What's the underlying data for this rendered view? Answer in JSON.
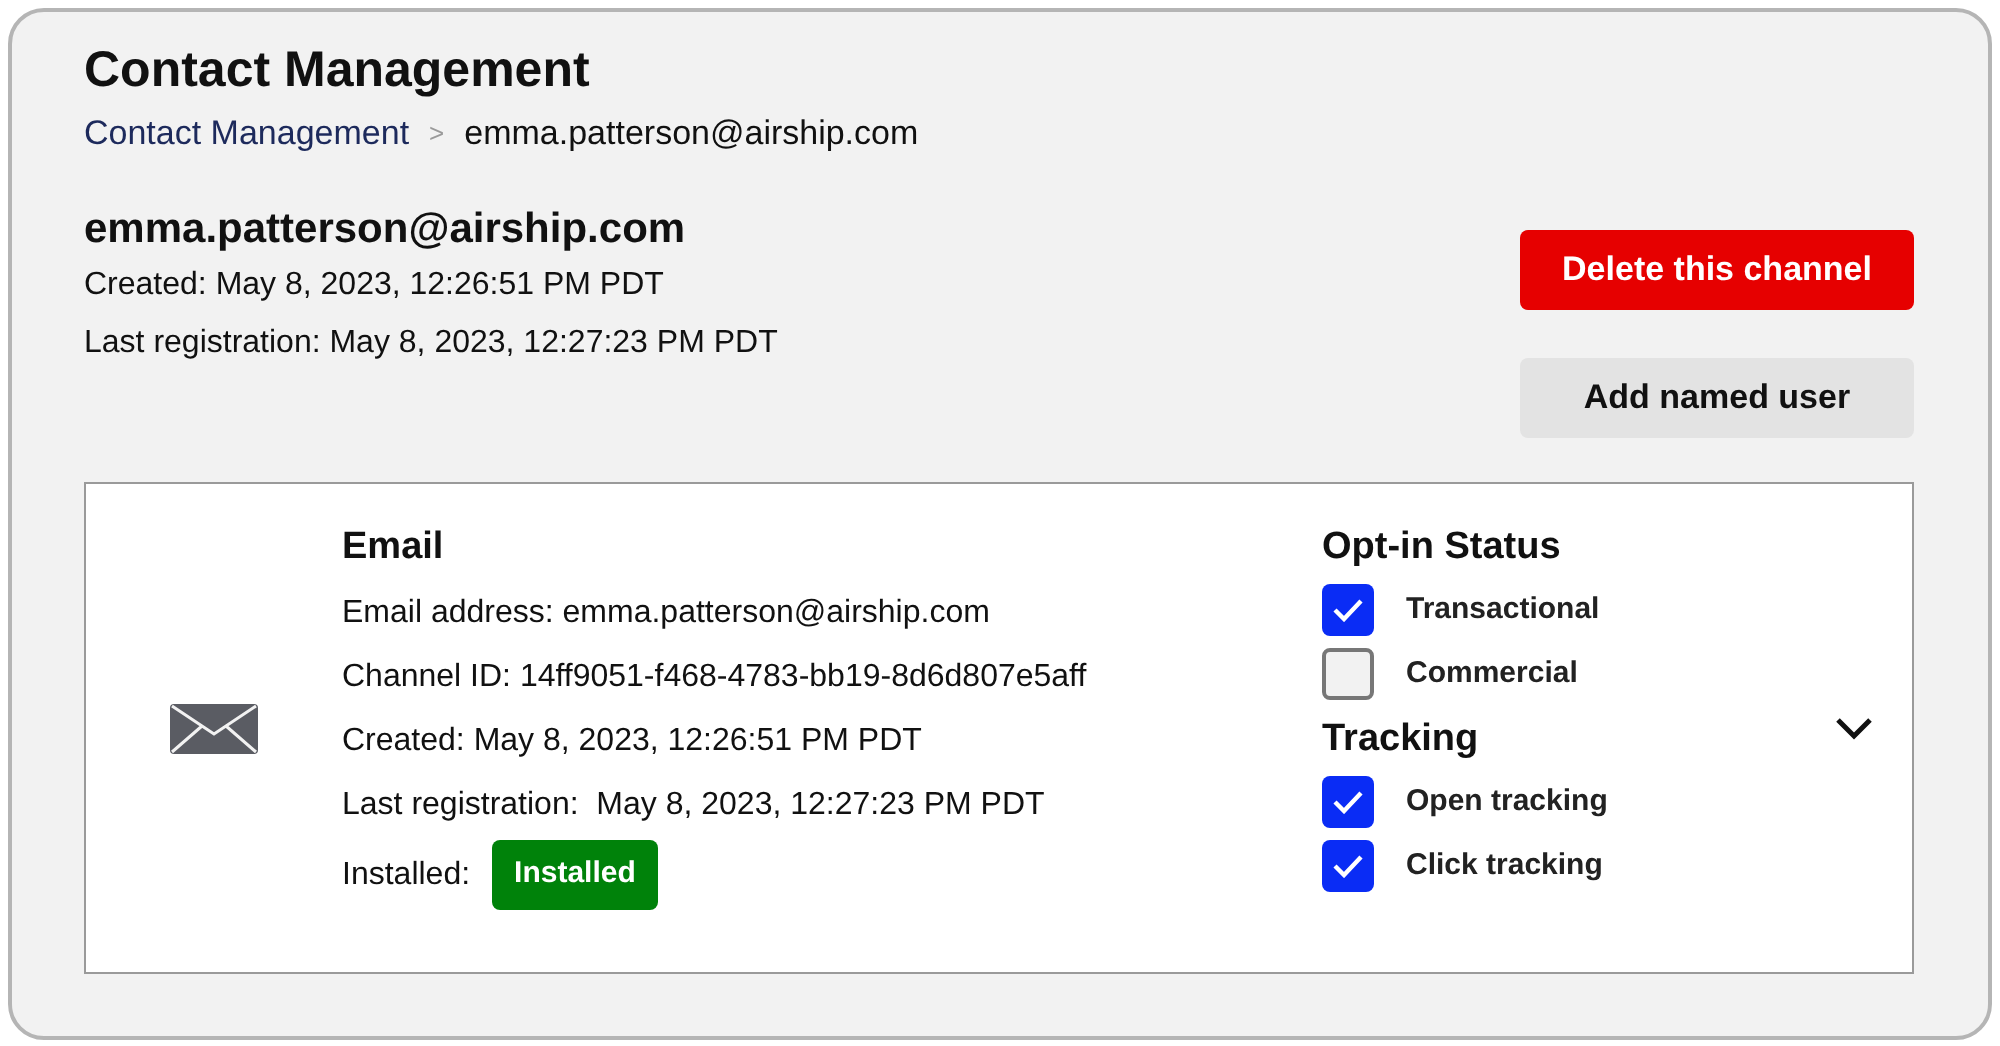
{
  "title": "Contact Management",
  "breadcrumb": {
    "link": "Contact Management",
    "separator": ">",
    "current": "emma.patterson@airship.com"
  },
  "channel": {
    "heading": "emma.patterson@airship.com",
    "details": [
      "Created: May 8, 2023, 12:26:51 PM PDT",
      "Last registration: May 8, 2023, 12:27:23 PM PDT"
    ]
  },
  "buttons": [
    {
      "label": "Delete this channel",
      "kind": "danger"
    },
    {
      "label": "Add named user",
      "kind": "secondary"
    }
  ],
  "card": {
    "title": "Email",
    "lines": [
      "Email address: emma.patterson@airship.com",
      "Channel ID: 14ff9051-f468-4783-bb19-8d6d807e5aff",
      "Created: May 8, 2023, 12:26:51 PM PDT",
      "Last registration:  May 8, 2023, 12:27:23 PM PDT"
    ],
    "installed": {
      "label": "Installed:",
      "badge": "Installed"
    },
    "groups": [
      {
        "heading": "Opt-in Status",
        "items": [
          {
            "label": "Transactional",
            "checked": true
          },
          {
            "label": "Commercial",
            "checked": false
          }
        ]
      },
      {
        "heading": "Tracking",
        "items": [
          {
            "label": "Open tracking",
            "checked": true
          },
          {
            "label": "Click tracking",
            "checked": true
          }
        ]
      }
    ]
  }
}
